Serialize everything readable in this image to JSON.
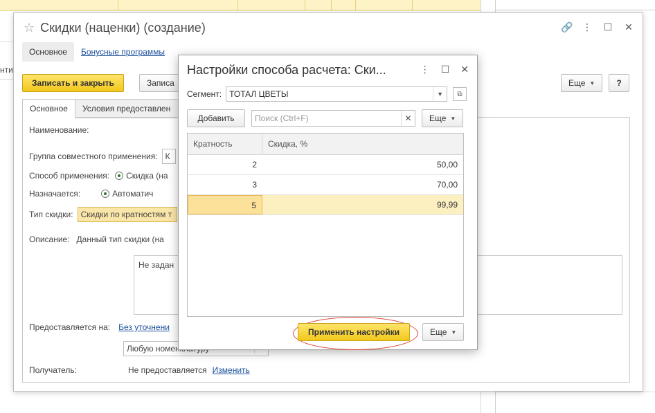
{
  "main_form": {
    "title": "Скидки (наценки) (создание)",
    "tabs": [
      "Основное",
      "Бонусные программы"
    ],
    "save_close": "Записать и закрыть",
    "write_partial": "Записа",
    "more": "Еще",
    "help": "?",
    "content_tabs": [
      "Основное",
      "Условия предоставлен"
    ],
    "fields": {
      "name_label": "Наименование:",
      "group_label": "Группа совместного применения:",
      "group_value": "К",
      "method_label": "Способ применения:",
      "method_value": "Скидка (на",
      "assigned_label": "Назначается:",
      "assigned_value": "Автоматич",
      "type_label": "Тип скидки:",
      "type_value": "Скидки по кратностям т",
      "desc_label": "Описание:",
      "desc_value": "Данный тип скидки (на",
      "notset_text": "Не задан",
      "provided_on_label": "Предоставляется на:",
      "provided_on_link": "Без уточнени",
      "nomenclature_value": "Любую номенклатуру",
      "recipient_label": "Получатель:",
      "recipient_value": "Не предоставляется",
      "recipient_change": "Изменить"
    },
    "left_bg_text": "нти"
  },
  "dialog": {
    "title": "Настройки способа расчета: Ски...",
    "segment_label": "Сегмент:",
    "segment_value": "ТОТАЛ ЦВЕТЫ",
    "add_button": "Добавить",
    "search_placeholder": "Поиск (Ctrl+F)",
    "more": "Еще",
    "columns": [
      "Кратность",
      "Скидка, %"
    ],
    "rows": [
      {
        "multiplicity": "2",
        "discount": "50,00"
      },
      {
        "multiplicity": "3",
        "discount": "70,00"
      },
      {
        "multiplicity": "5",
        "discount": "99,99"
      }
    ],
    "apply_button": "Применить настройки"
  },
  "colors": {
    "accent_yellow": "#f2c81c",
    "link_blue": "#1b4f9b",
    "highlight_red": "#e0402a",
    "selected_row": "#fcefc0"
  }
}
